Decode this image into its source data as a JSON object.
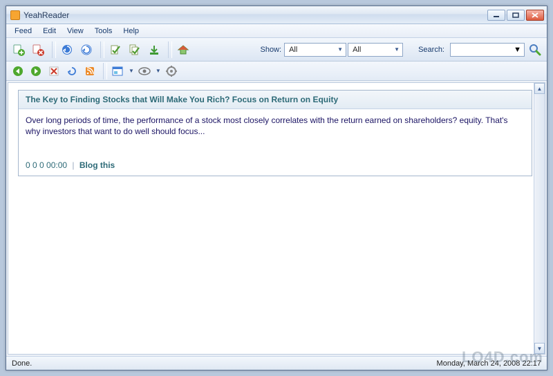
{
  "app": {
    "title": "YeahReader"
  },
  "menu": {
    "feed": "Feed",
    "edit": "Edit",
    "view": "View",
    "tools": "Tools",
    "help": "Help"
  },
  "toolbar1": {
    "show_label": "Show:",
    "show_combo1": "All",
    "show_combo2": "All",
    "search_label": "Search:",
    "search_value": ""
  },
  "icons": {
    "add_feed": "add-feed-icon",
    "remove_feed": "remove-feed-icon",
    "refresh_all": "refresh-all-icon",
    "refresh": "refresh-icon",
    "mark_read": "mark-read-icon",
    "mark_all": "mark-all-read-icon",
    "import": "import-icon",
    "home": "home-icon",
    "back": "back-icon",
    "forward": "forward-icon",
    "stop": "stop-icon",
    "reload": "reload-icon",
    "feed_page": "feed-page-icon",
    "view_mode": "view-mode-icon",
    "eye": "eye-icon",
    "options": "options-icon",
    "search": "search-icon"
  },
  "entry": {
    "title": "The Key to Finding Stocks that Will Make You Rich? Focus on Return on Equity",
    "body": "Over long periods of time, the performance of a stock most closely correlates with the return earned on shareholders? equity. That's why investors that want to do well should focus...",
    "meta": "0 0 0 00:00",
    "blog_link": "Blog this"
  },
  "status": {
    "left": "Done.",
    "right": "Monday, March 24, 2008 22:17"
  },
  "watermark": "LO4D.com"
}
